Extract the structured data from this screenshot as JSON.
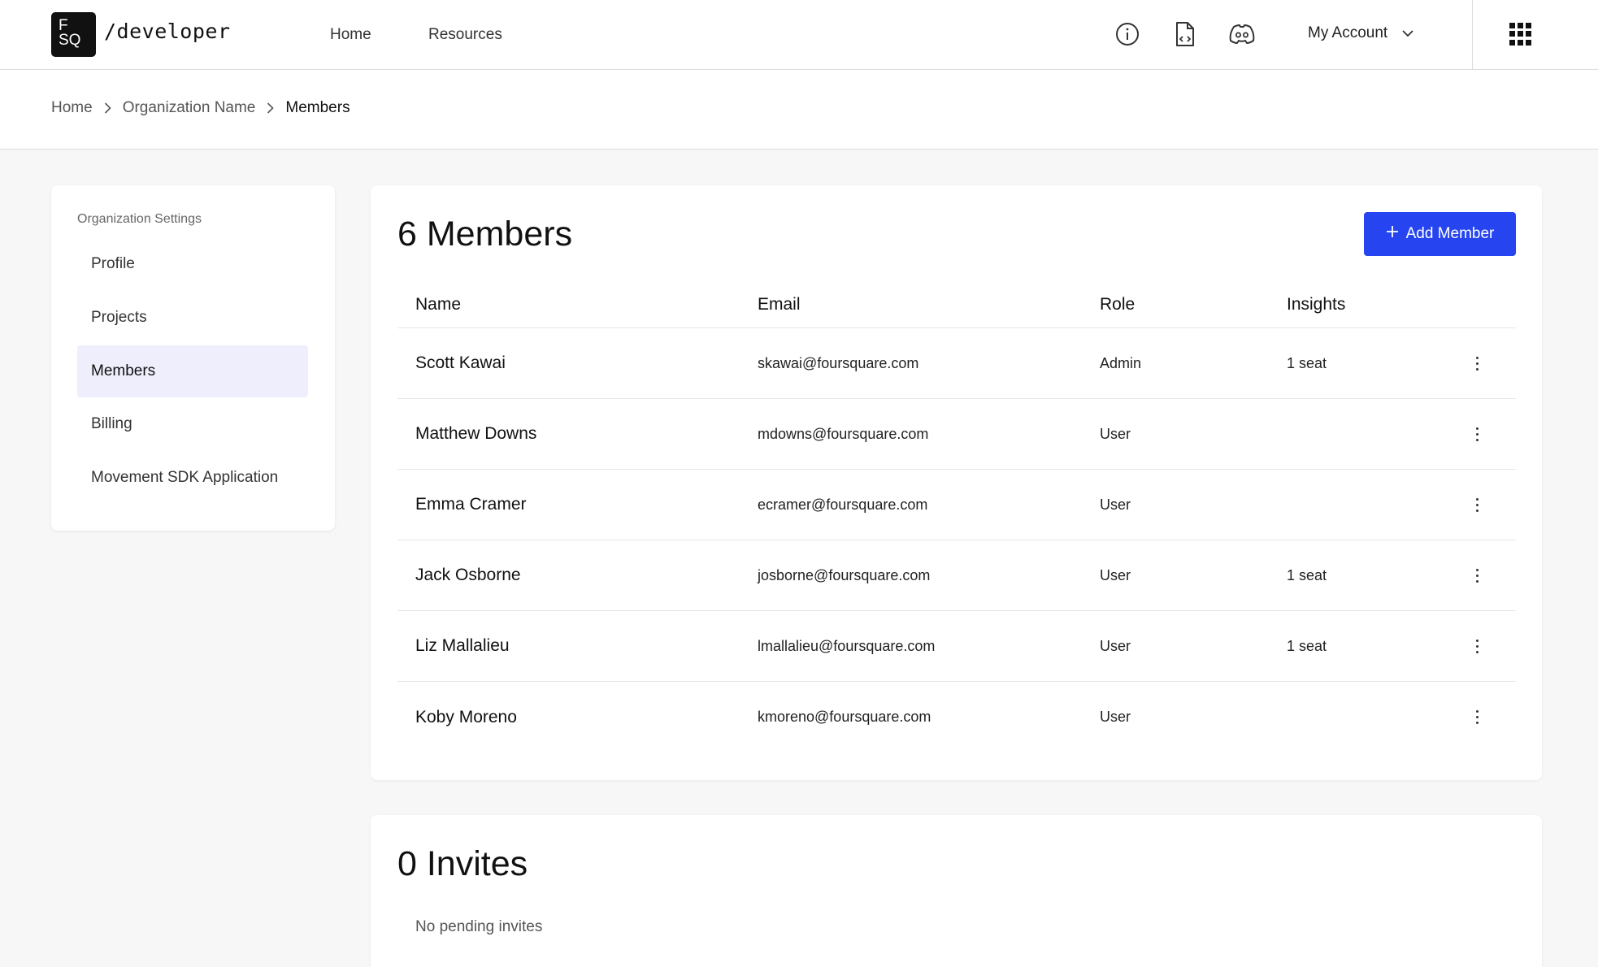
{
  "header": {
    "logo_line1": "F",
    "logo_line2": "SQ",
    "brand": "/developer",
    "nav": {
      "home": "Home",
      "resources": "Resources"
    },
    "account_label": "My Account",
    "icons": [
      "info-icon",
      "code-doc-icon",
      "discord-icon",
      "chevron-down-icon",
      "apps-grid-icon"
    ]
  },
  "breadcrumb": {
    "items": [
      "Home",
      "Organization Name",
      "Members"
    ]
  },
  "sidebar": {
    "title": "Organization Settings",
    "items": [
      {
        "label": "Profile",
        "active": false
      },
      {
        "label": "Projects",
        "active": false
      },
      {
        "label": "Members",
        "active": true
      },
      {
        "label": "Billing",
        "active": false
      },
      {
        "label": "Movement SDK Application",
        "active": false
      }
    ]
  },
  "members": {
    "title": "6 Members",
    "add_button": "Add Member",
    "columns": [
      "Name",
      "Email",
      "Role",
      "Insights"
    ],
    "rows": [
      {
        "name": "Scott Kawai",
        "email": "skawai@foursquare.com",
        "role": "Admin",
        "insights": "1 seat"
      },
      {
        "name": "Matthew Downs",
        "email": "mdowns@foursquare.com",
        "role": "User",
        "insights": ""
      },
      {
        "name": "Emma Cramer",
        "email": "ecramer@foursquare.com",
        "role": "User",
        "insights": ""
      },
      {
        "name": "Jack Osborne",
        "email": "josborne@foursquare.com",
        "role": "User",
        "insights": "1 seat"
      },
      {
        "name": "Liz Mallalieu",
        "email": "lmallalieu@foursquare.com",
        "role": "User",
        "insights": "1 seat"
      },
      {
        "name": "Koby Moreno",
        "email": "kmoreno@foursquare.com",
        "role": "User",
        "insights": ""
      }
    ]
  },
  "invites": {
    "title": "0 Invites",
    "empty_text": "No pending invites"
  },
  "colors": {
    "accent": "#2645f0",
    "active_nav_bg": "#eeeefc",
    "page_bg": "#f7f7f7"
  }
}
